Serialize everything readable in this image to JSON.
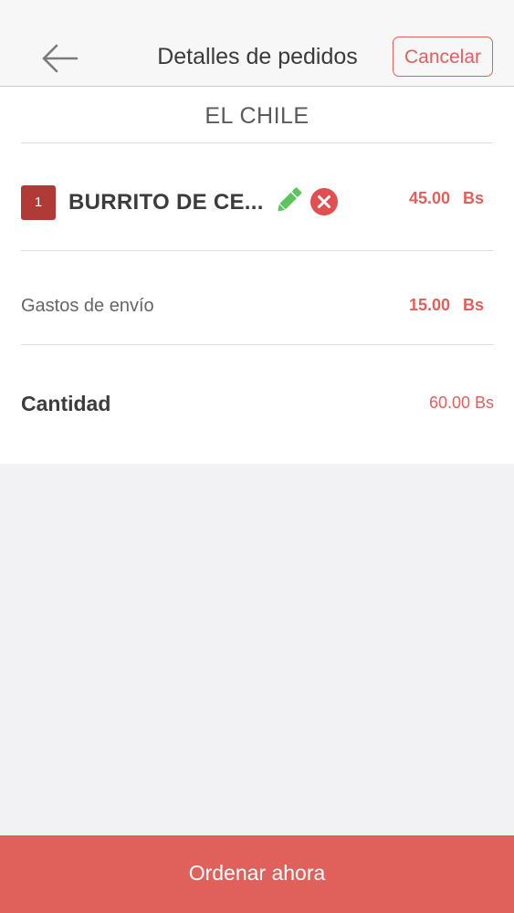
{
  "header": {
    "title": "Detalles de pedidos",
    "cancel_label": "Cancelar"
  },
  "store": {
    "name": "EL CHILE"
  },
  "items": [
    {
      "quantity": "1",
      "name": "BURRITO DE CE...",
      "price": "45.00",
      "currency": "Bs"
    }
  ],
  "shipping": {
    "label": "Gastos de envío",
    "price": "15.00",
    "currency": "Bs"
  },
  "total": {
    "label": "Cantidad",
    "price": "60.00 Bs"
  },
  "footer": {
    "order_label": "Ordenar ahora"
  },
  "colors": {
    "accent": "#e0605b",
    "badge": "#b03a36",
    "edit_icon": "#5cc45c"
  },
  "icons": {
    "back": "back-arrow-icon",
    "edit": "pencil-icon",
    "remove": "remove-circle-icon"
  }
}
